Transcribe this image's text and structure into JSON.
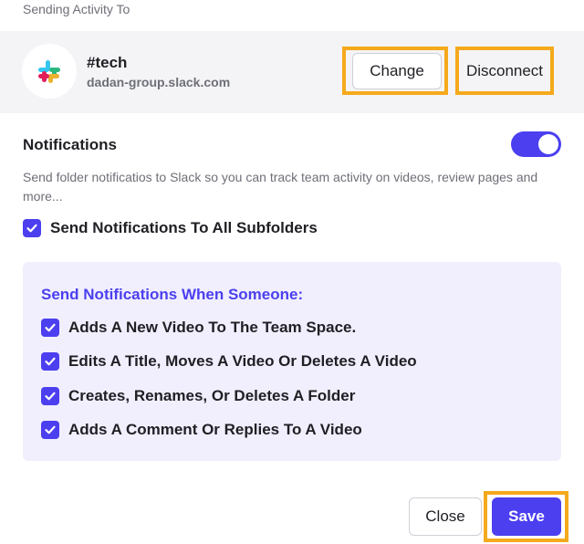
{
  "section_label": "Sending Activity To",
  "channel": {
    "name": "#tech",
    "workspace": "dadan-group.slack.com",
    "change_label": "Change",
    "disconnect_label": "Disconnect"
  },
  "notifications": {
    "title": "Notifications",
    "enabled": true,
    "description": "Send folder notificatios to Slack so you can track team activity on videos, review pages and more...",
    "subfolders_label": "Send Notifications To All Subfolders",
    "subfolders_checked": true
  },
  "panel": {
    "title": "Send Notifications When Someone:",
    "options": [
      {
        "label": "Adds A New Video To The Team Space.",
        "checked": true
      },
      {
        "label": "Edits A Title, Moves A Video Or Deletes A Video",
        "checked": true
      },
      {
        "label": "Creates, Renames, Or Deletes A Folder",
        "checked": true
      },
      {
        "label": "Adds A Comment Or Replies To A Video",
        "checked": true
      }
    ]
  },
  "footer": {
    "close_label": "Close",
    "save_label": "Save"
  },
  "colors": {
    "accent": "#4b3ff0",
    "highlight": "#f5a91c",
    "panel_bg": "#f1effd"
  },
  "icons": {
    "logo": "slack-logo-icon",
    "check": "checkmark-icon"
  }
}
